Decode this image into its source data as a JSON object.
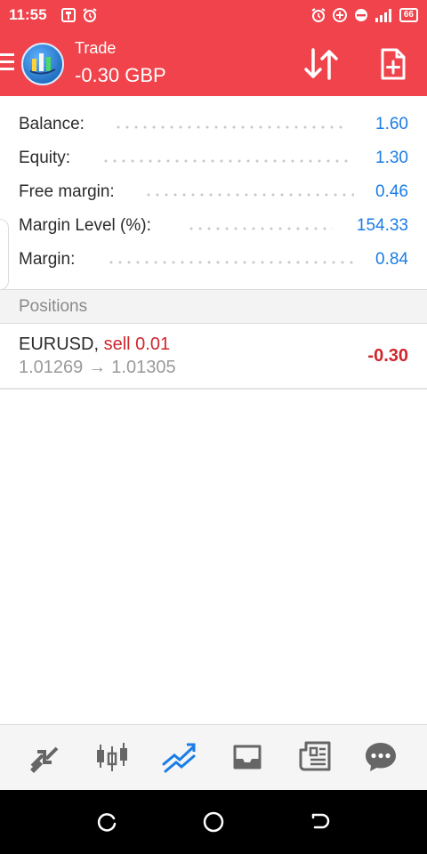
{
  "status_bar": {
    "time": "11:55",
    "battery": "66",
    "icons_left": [
      "sim-toolkit-icon",
      "alarm-icon"
    ],
    "icons_right": [
      "alarm-icon",
      "add-circle-icon",
      "do-not-disturb-icon",
      "signal-icon",
      "battery-icon"
    ]
  },
  "app_bar": {
    "title": "Trade",
    "subtitle": "-0.30 GBP",
    "accent": "#f0434b"
  },
  "account": {
    "rows": [
      {
        "label": "Balance:",
        "value": "1.60"
      },
      {
        "label": "Equity:",
        "value": "1.30"
      },
      {
        "label": "Free margin:",
        "value": "0.46"
      },
      {
        "label": "Margin Level (%):",
        "value": "154.33"
      },
      {
        "label": "Margin:",
        "value": "0.84"
      }
    ],
    "value_color": "#1a7ce6"
  },
  "positions": {
    "title": "Positions",
    "items": [
      {
        "symbol": "EURUSD,",
        "side": "sell 0.01",
        "open_price": "1.01269",
        "arrow": "→",
        "current_price": "1.01305",
        "profit": "-0.30"
      }
    ],
    "loss_color": "#d0252c"
  },
  "bottom_nav": {
    "items": [
      "quotes-icon",
      "chart-icon",
      "trade-icon",
      "history-icon",
      "news-icon",
      "messages-icon"
    ],
    "active": "trade-icon"
  },
  "system_nav": [
    "recents-icon",
    "home-icon",
    "back-icon"
  ]
}
